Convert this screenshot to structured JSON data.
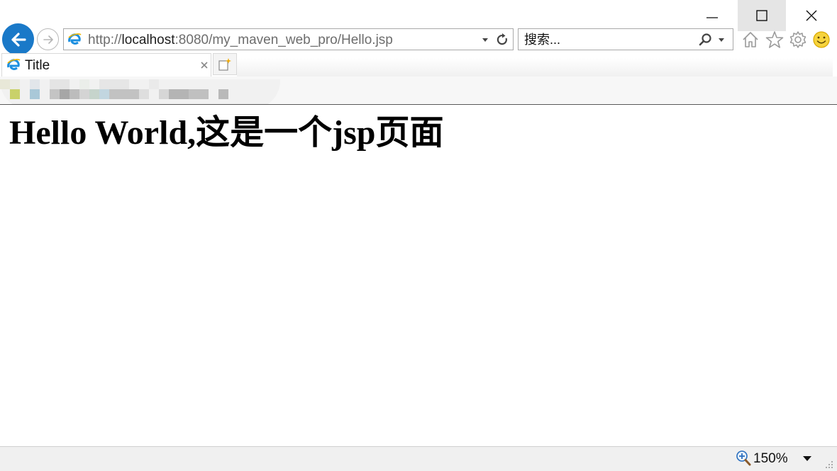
{
  "window": {
    "controls": [
      "minimize-icon",
      "maximize-icon",
      "close-icon"
    ]
  },
  "nav": {
    "back_icon": "back-arrow-icon",
    "forward_icon": "forward-arrow-icon"
  },
  "address_bar": {
    "url_prefix": "http://",
    "url_host": "localhost",
    "url_rest": ":8080/my_maven_web_pro/Hello.jsp",
    "brand_color": "#1a79c8"
  },
  "search": {
    "placeholder": "搜索..."
  },
  "toolbar": {
    "icons": [
      "home-icon",
      "favorites-star-icon",
      "settings-gear-icon",
      "feedback-smiley-icon"
    ]
  },
  "tab": {
    "title": "Title"
  },
  "page": {
    "heading": "Hello World,这是一个jsp页面"
  },
  "status_bar": {
    "zoom": "150%"
  }
}
